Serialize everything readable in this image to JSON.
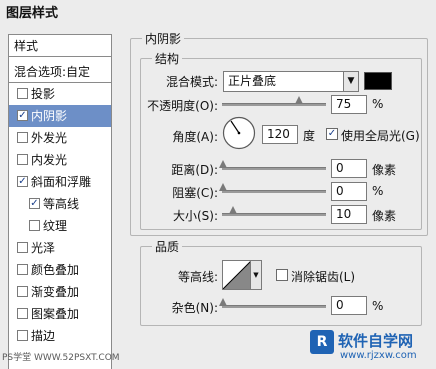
{
  "window": {
    "title": "图层样式"
  },
  "sidebar": {
    "header": "样式",
    "blend_options": "混合选项:自定",
    "items": [
      {
        "label": "投影",
        "checked": ""
      },
      {
        "label": "内阴影",
        "checked": "✓"
      },
      {
        "label": "外发光",
        "checked": ""
      },
      {
        "label": "内发光",
        "checked": ""
      },
      {
        "label": "斜面和浮雕",
        "checked": "✓"
      },
      {
        "label": "等高线",
        "checked": "✓"
      },
      {
        "label": "纹理",
        "checked": ""
      },
      {
        "label": "光泽",
        "checked": ""
      },
      {
        "label": "颜色叠加",
        "checked": ""
      },
      {
        "label": "渐变叠加",
        "checked": ""
      },
      {
        "label": "图案叠加",
        "checked": ""
      },
      {
        "label": "描边",
        "checked": ""
      }
    ]
  },
  "panel": {
    "title": "内阴影",
    "structure": {
      "title": "结构",
      "blend_mode_label": "混合模式:",
      "blend_mode_value": "正片叠底",
      "blend_color": "#000000",
      "opacity_label": "不透明度(O):",
      "opacity_value": "75",
      "opacity_unit": "%",
      "angle_label": "角度(A):",
      "angle_value": "120",
      "angle_unit": "度",
      "global_light_label": "使用全局光(G)",
      "global_light_checked": "✓",
      "distance_label": "距离(D):",
      "distance_value": "0",
      "distance_unit": "像素",
      "choke_label": "阻塞(C):",
      "choke_value": "0",
      "choke_unit": "%",
      "size_label": "大小(S):",
      "size_value": "10",
      "size_unit": "像素"
    },
    "quality": {
      "title": "品质",
      "contour_label": "等高线:",
      "antialias_label": "消除锯齿(L)",
      "antialias_checked": "",
      "noise_label": "杂色(N):",
      "noise_value": "0",
      "noise_unit": "%"
    }
  },
  "watermark": {
    "left": "PS学堂 WWW.52PSXT.COM",
    "right_brand": "软件自学网",
    "right_url": "www.rjzxw.com"
  },
  "colors": {
    "selected": "#6d8fc7",
    "brand": "#1f63b4"
  }
}
